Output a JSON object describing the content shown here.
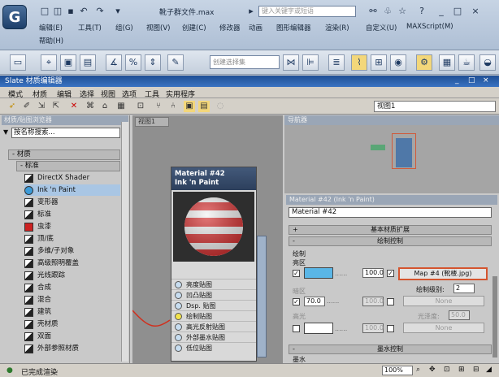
{
  "app": {
    "logo": "G",
    "filename": "靴子群文件.max",
    "search_placeholder": "键入关键字或短语",
    "menus": [
      "编辑(E)",
      "工具(T)",
      "组(G)",
      "视图(V)",
      "创建(C)",
      "修改器",
      "动画",
      "图形编辑器",
      "渲染(R)",
      "自定义(U)",
      "MAXScript(M)",
      "帮助(H)"
    ],
    "selection_set_placeholder": "创建选择集"
  },
  "slate": {
    "title": "Slate 材质编辑器",
    "menus": [
      "模式",
      "材质",
      "编辑",
      "选择",
      "视图",
      "选项",
      "工具",
      "实用程序"
    ],
    "view_select": "视图1"
  },
  "browser": {
    "title": "材质/贴图浏览器",
    "search_placeholder": "按名称搜索...",
    "category_materials": "- 材质",
    "category_standard": "- 标准",
    "items": [
      "DirectX Shader",
      "Ink 'n Paint",
      "变形器",
      "标准",
      "虫漆",
      "顶/底",
      "多维/子对象",
      "高级照明覆盖",
      "光线跟踪",
      "合成",
      "混合",
      "建筑",
      "壳材质",
      "双面",
      "外部参照材质"
    ],
    "colors": {
      "ink_swatch": "#3c9bd8",
      "shellac_swatch": "#cc2222"
    }
  },
  "view": {
    "tab": "视图1"
  },
  "node": {
    "title_line1": "Material #42",
    "title_line2": "Ink 'n Paint",
    "slots": [
      "亮度贴图",
      "凹凸贴图",
      "Dsp. 贴图",
      "绘制贴图",
      "高光反射贴图",
      "外部墨水贴图",
      "低位贴图"
    ]
  },
  "navigator": {
    "title": "导航器"
  },
  "params": {
    "title": "Material #42 (Ink 'n Paint)",
    "material_name": "Material #42",
    "roll_basic": "基本材质扩展",
    "roll_paint": "绘制控制",
    "paint_group": "绘制",
    "lit_label": "亮区",
    "lit_value": "100.0",
    "map_button": "Map #4 (靴楼.jpg)",
    "paint_levels_label": "绘制级别:",
    "paint_levels_value": "2",
    "shaded_label": "暗区",
    "shaded_value": "70.0",
    "shaded_value2": "100.0",
    "none_label": "None",
    "highlight_label": "高光",
    "gloss_label": "光泽度:",
    "gloss_value": "50.0",
    "highlight_value": "100.0",
    "roll_ink": "墨水控制",
    "ink_label": "墨水",
    "colors": {
      "lit": "#5ab6e6",
      "map_border": "#d4552f"
    }
  },
  "status": {
    "text": "已完成渲染",
    "zoom": "100%"
  }
}
